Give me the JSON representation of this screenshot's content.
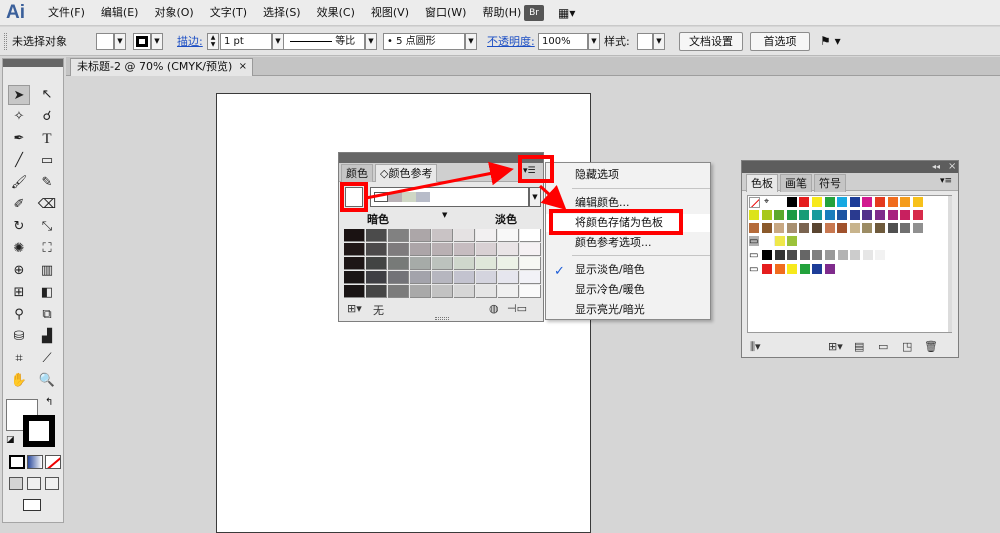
{
  "app": {
    "logo": "Ai",
    "bridge": "Br",
    "layout_icon": "▦▾"
  },
  "menu": [
    "文件(F)",
    "编辑(E)",
    "对象(O)",
    "文字(T)",
    "选择(S)",
    "效果(C)",
    "视图(V)",
    "窗口(W)",
    "帮助(H)"
  ],
  "control": {
    "selection_status": "未选择对象",
    "stroke_label": "描边:",
    "stroke_weight": "1 pt",
    "profile_label": "等比",
    "brush_label": "• 5 点圆形",
    "opacity_label": "不透明度:",
    "opacity_value": "100%",
    "style_label": "样式:",
    "doc_setup": "文档设置",
    "preferences": "首选项"
  },
  "document": {
    "tab_title": "未标题-2 @ 70% (CMYK/预览)",
    "tab_close": "×"
  },
  "guide_panel": {
    "tab_color": "颜色",
    "tab_guide": "◇颜色参考",
    "menu_icon": "▾☰",
    "shades_label": "暗色",
    "tints_label": "淡色",
    "footer_none": "无",
    "harmony_colors": [
      "#ffffff",
      "#b9b1b6",
      "#cfd7c5",
      "#b8bcc9"
    ],
    "grid_rows": [
      [
        "#1a1212",
        "#4b4b4b",
        "#818181",
        "#aca6a8",
        "#c9c3c5",
        "#e5e2e3",
        "#f2f0f1",
        "#f8f8f8",
        "#ffffff"
      ],
      [
        "#211818",
        "#4c4a4b",
        "#7e7b7d",
        "#aca5a8",
        "#b9b0b3",
        "#c6bcc0",
        "#d8d0d3",
        "#e9e4e6",
        "#f5f1f3"
      ],
      [
        "#1d1616",
        "#424443",
        "#777a78",
        "#a6aba8",
        "#bcc2bd",
        "#cfd7cc",
        "#dfe7da",
        "#ecf2e7",
        "#f6f8f3"
      ],
      [
        "#1a1515",
        "#3f3f44",
        "#737378",
        "#a3a3ab",
        "#b6b6bf",
        "#c3c3cf",
        "#d4d4de",
        "#e6e6ee",
        "#f2f2f7"
      ],
      [
        "#191414",
        "#464646",
        "#7b7b7b",
        "#a9a9a9",
        "#c2c2c2",
        "#d6d6d6",
        "#e5e5e5",
        "#f0f0f0",
        "#fafafa"
      ]
    ]
  },
  "flyout": {
    "items": [
      "隐藏选项",
      "编辑颜色...",
      "将颜色存储为色板",
      "颜色参考选项...",
      "显示淡色/暗色",
      "显示冷色/暖色",
      "显示亮光/暗光"
    ],
    "checkmark": "✓"
  },
  "swatches_panel": {
    "tabs": [
      "色板",
      "画笔",
      "符号"
    ],
    "collapse": "◂◂",
    "close": "×",
    "menu_icon": "▾≡",
    "rows": [
      [
        "none",
        "reg",
        "#ffffff",
        "#000000",
        "#e51d1d",
        "#f7e91b",
        "#23a23c",
        "#17a9e1",
        "#1d3d98",
        "#d11a8f",
        "#e43a1e",
        "#f06c1e",
        "#f59c1b",
        "#f7c11b"
      ],
      [
        "#dce31b",
        "#a8c81c",
        "#5ca92d",
        "#1c9a45",
        "#169c76",
        "#179a9c",
        "#1a7dbd",
        "#1d55a3",
        "#2a3a8f",
        "#53308a",
        "#7f2b8c",
        "#a7237f",
        "#c8205f",
        "#d72a4a"
      ],
      [
        "#b56b3a",
        "#8b5a2b",
        "#c8a882",
        "#a89070",
        "#7a6450",
        "#5a4530",
        "#c87850",
        "#a0522d",
        "#c8b48c",
        "#9c8c64",
        "#6e5a3c",
        "#505050",
        "#707070",
        "#909090"
      ],
      [
        "#b0b0b0",
        "#d0d0d0",
        "#e8e8e8"
      ]
    ],
    "group_row1": [
      "#ffffff",
      "#efe84a",
      "#9bc23a"
    ],
    "group_row2": [
      "#000000",
      "#333333",
      "#4d4d4d",
      "#666666",
      "#808080",
      "#999999",
      "#b3b3b3",
      "#cccccc",
      "#e6e6e6",
      "#f2f2f2"
    ],
    "group_row3": [
      "#e51d1d",
      "#f06c1e",
      "#f7e91b",
      "#23a23c",
      "#1d3d98",
      "#7f2b8c"
    ]
  }
}
